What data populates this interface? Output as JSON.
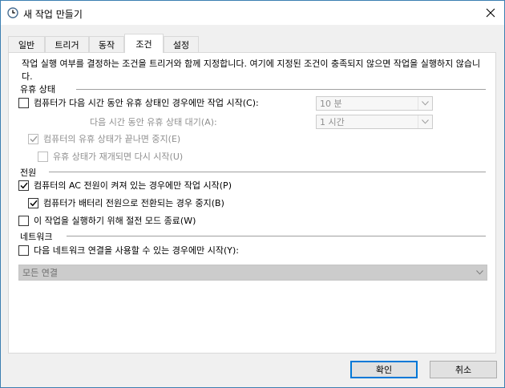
{
  "window": {
    "title": "새 작업 만들기"
  },
  "tabs": [
    {
      "label": "일반"
    },
    {
      "label": "트리거"
    },
    {
      "label": "동작"
    },
    {
      "label": "조건"
    },
    {
      "label": "설정"
    }
  ],
  "active_tab": "조건",
  "description": "작업 실행 여부를 결정하는 조건을 트리거와 함께 지정합니다. 여기에 지정된 조건이 충족되지 않으면 작업을 실행하지 않습니다.",
  "idle": {
    "section": "유휴 상태",
    "start_only_if_idle": {
      "label": "컴퓨터가 다음 시간 동안 유휴 상태인 경우에만 작업 시작(C):",
      "checked": false
    },
    "idle_duration": {
      "value": "10 분"
    },
    "wait_label": "다음 시간 동안 유휴 상태 대기(A):",
    "wait_duration": {
      "value": "1 시간"
    },
    "stop_if_not_idle": {
      "label": "컴퓨터의 유휴 상태가 끝나면 중지(E)",
      "checked": true
    },
    "restart_if_idle": {
      "label": "유휴 상태가 재개되면 다시 시작(U)",
      "checked": false
    }
  },
  "power": {
    "section": "전원",
    "ac_only": {
      "label": "컴퓨터의 AC 전원이 켜져 있는 경우에만 작업 시작(P)",
      "checked": true
    },
    "stop_on_battery": {
      "label": "컴퓨터가 배터리 전원으로 전환되는 경우 중지(B)",
      "checked": true
    },
    "wake": {
      "label": "이 작업을 실행하기 위해 절전 모드 종료(W)",
      "checked": false
    }
  },
  "network": {
    "section": "네트워크",
    "only_if_network": {
      "label": "다음 네트워크 연결을 사용할 수 있는 경우에만 시작(Y):",
      "checked": false
    },
    "connection": {
      "value": "모든 연결"
    }
  },
  "buttons": {
    "ok": "확인",
    "cancel": "취소"
  },
  "colors": {
    "accent": "#0078d7",
    "window_border": "#3c7fb1",
    "disabled_text": "#8f8f8f"
  },
  "icons": {
    "title": "task-scheduler-clock-icon",
    "close": "close-icon",
    "check": "check-icon",
    "dropdown": "chevron-down-icon"
  }
}
